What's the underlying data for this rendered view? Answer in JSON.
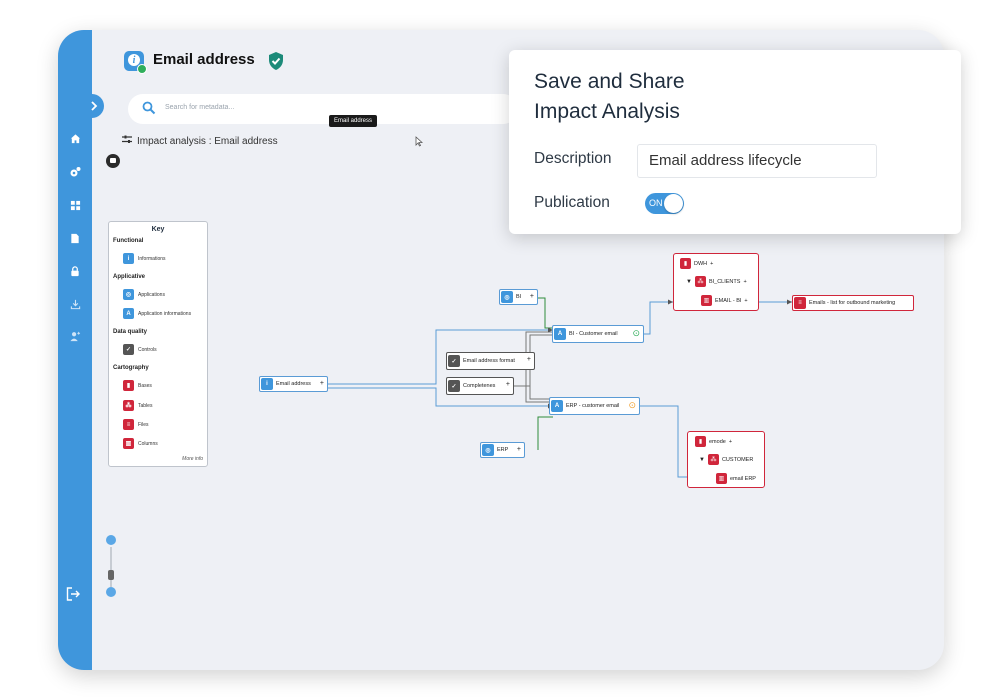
{
  "header": {
    "title": "Email address",
    "verified_icon": "shield-check-icon"
  },
  "search": {
    "placeholder": "Search for metadata..."
  },
  "tooltip": {
    "text": "Email address"
  },
  "breadcrumb": {
    "text": "Impact analysis : Email address"
  },
  "sidebar": {
    "icons": [
      "home-icon",
      "gears-icon",
      "grid-icon",
      "document-icon",
      "lock-icon",
      "download-icon",
      "add-user-icon"
    ],
    "logout_icon": "logout-icon"
  },
  "key": {
    "title": "Key",
    "sections": [
      {
        "label": "Functional",
        "items": [
          "Informations"
        ]
      },
      {
        "label": "Applicative",
        "items": [
          "Applications",
          "Application informations"
        ]
      },
      {
        "label": "Data quality",
        "items": [
          "Controls"
        ]
      },
      {
        "label": "Cartography",
        "items": [
          "Bases",
          "Tables",
          "Files",
          "Columns"
        ]
      }
    ],
    "more": "More info"
  },
  "graph": {
    "email_address": "Email address",
    "bi_app": "BI",
    "erp_app": "ERP",
    "email_format": "Email address format",
    "completeness": "Completenes",
    "bi_customer_email": "BI - Customer email",
    "erp_customer_email": "ERP - customer email",
    "dwh_group": {
      "base": "DWH",
      "table": "BI_CLIENTS",
      "column": "EMAIL - BI"
    },
    "emails_file": "Emails - list for outbound marketing",
    "emode_group": {
      "base": "emode",
      "table": "CUSTOMER",
      "column": "email ERP"
    },
    "plus": "+"
  },
  "panel": {
    "title": "Save and Share\nImpact Analysis",
    "description_label": "Description",
    "description_value": "Email address lifecycle",
    "publication_label": "Publication",
    "publication_state": "ON"
  },
  "colors": {
    "accent": "#3f96dc",
    "cartography": "#d0263b",
    "success": "#2fae5b",
    "warning": "#f0a030"
  }
}
